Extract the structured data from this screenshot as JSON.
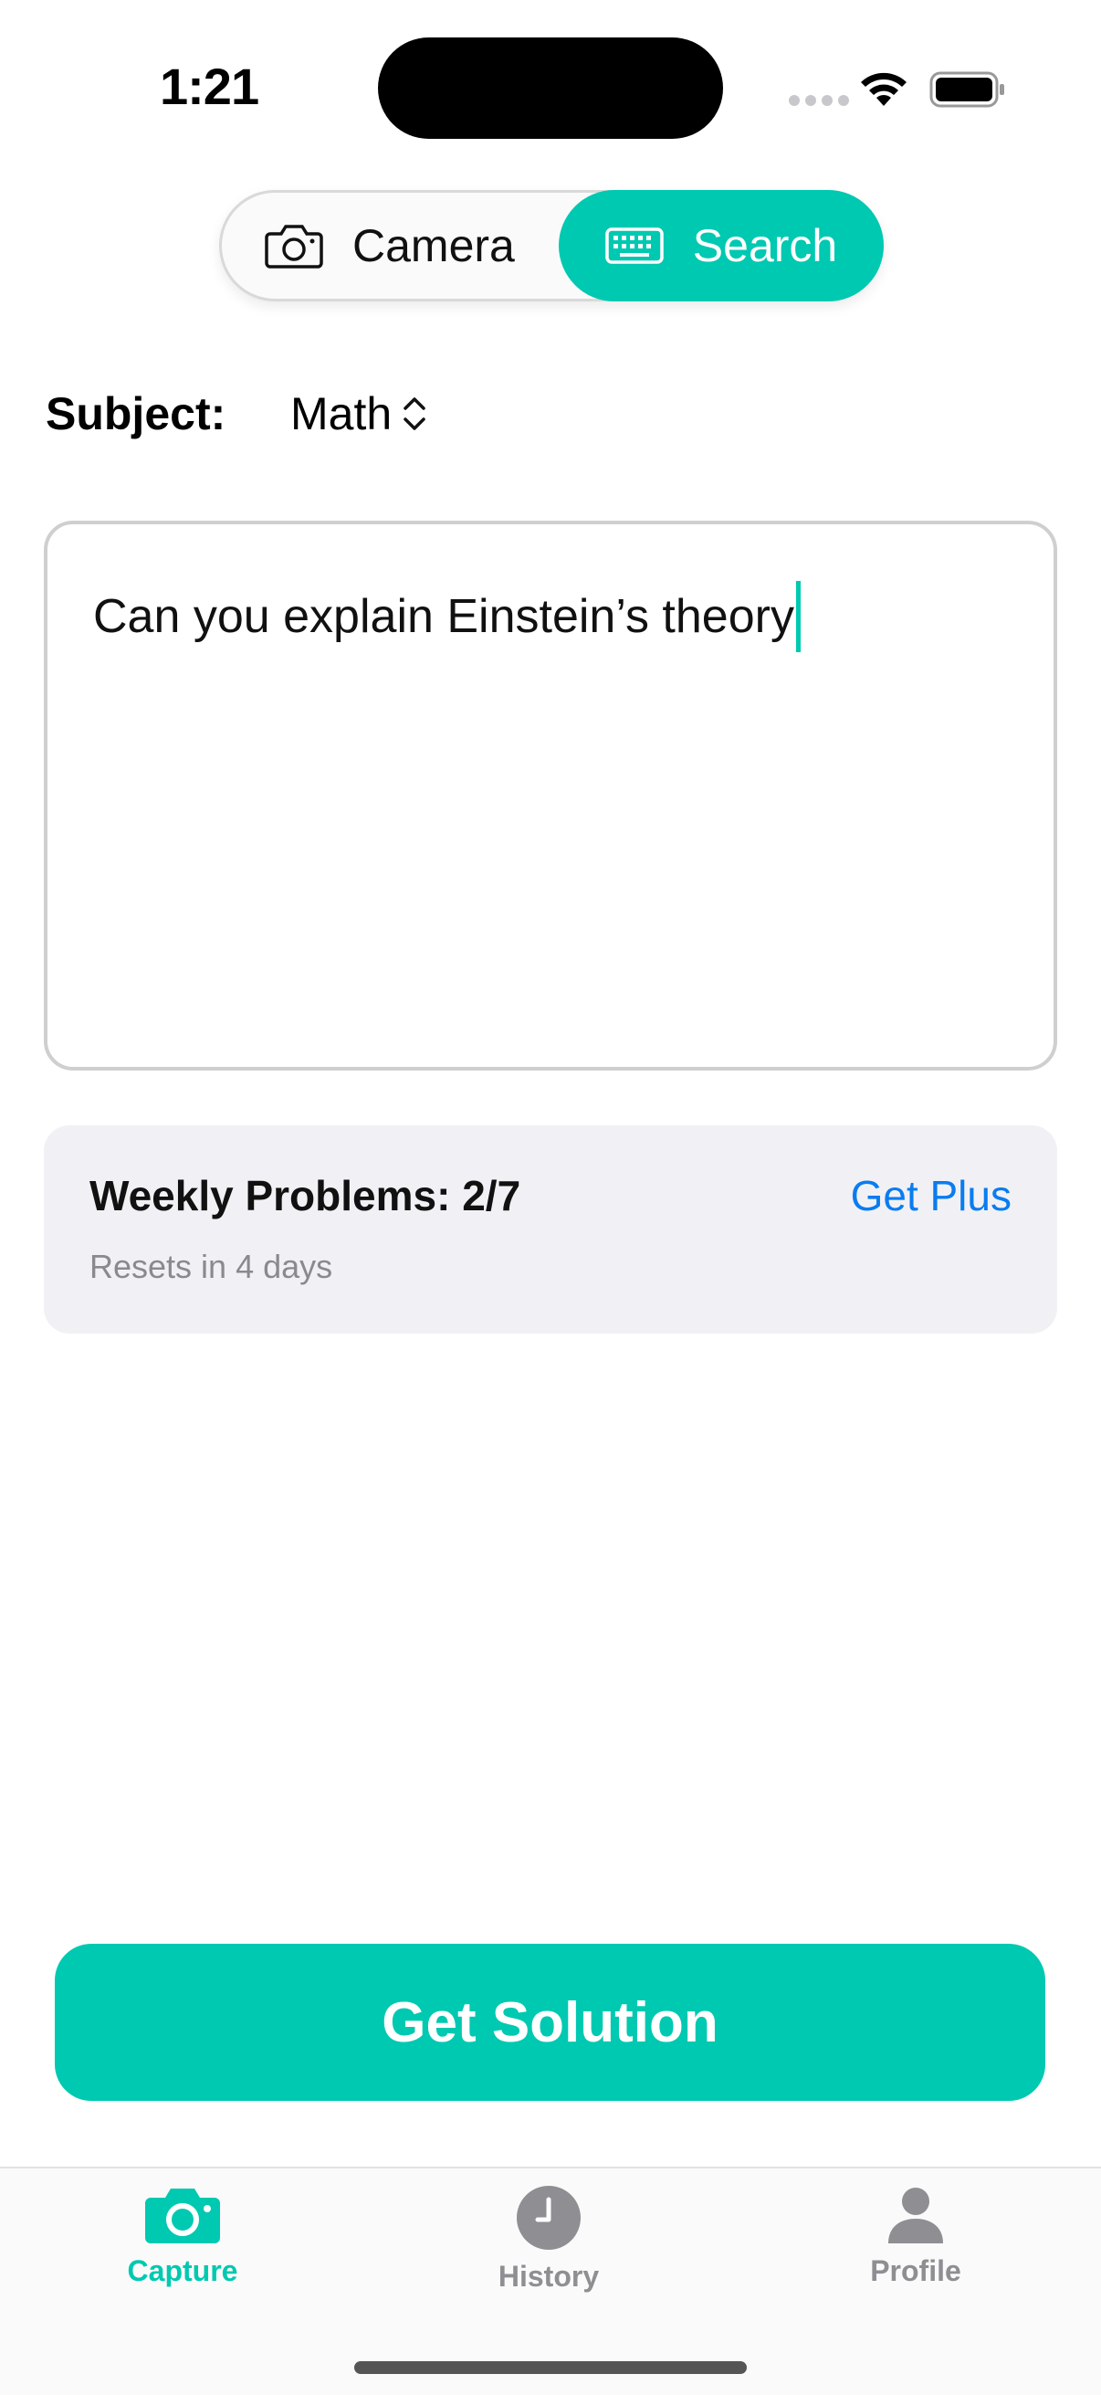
{
  "status_bar": {
    "time": "1:21"
  },
  "mode_toggle": {
    "camera_label": "Camera",
    "search_label": "Search",
    "selected": "Search"
  },
  "subject": {
    "label": "Subject:",
    "value": "Math"
  },
  "query_input": {
    "value": "Can you explain Einstein’s theory"
  },
  "weekly": {
    "title": "Weekly Problems: 2/7",
    "reset_text": "Resets in 4 days",
    "upgrade_link": "Get Plus"
  },
  "primary_action": {
    "label": "Get Solution"
  },
  "tabbar": {
    "items": [
      {
        "label": "Capture",
        "icon": "camera-icon",
        "active": true
      },
      {
        "label": "History",
        "icon": "clock-icon",
        "active": false
      },
      {
        "label": "Profile",
        "icon": "person-icon",
        "active": false
      }
    ]
  },
  "colors": {
    "accent": "#00c9b1",
    "link": "#0a7cf0",
    "card_bg": "#f1f1f5"
  }
}
